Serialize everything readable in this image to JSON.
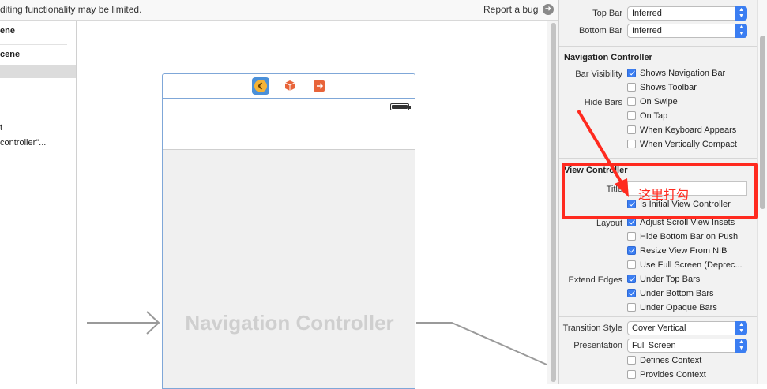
{
  "topbar": {
    "message": "diting functionality may be limited.",
    "report_label": "Report a bug",
    "report_icon": "arrow-right-circle-icon"
  },
  "outline": {
    "items": [
      "ene",
      "cene",
      "",
      "t",
      "controller\"..."
    ]
  },
  "scene": {
    "title": "Navigation Controller",
    "dock_icons": [
      "back-chevron-icon",
      "cube-icon",
      "exit-icon"
    ]
  },
  "inspector": {
    "top_bar_label": "Top Bar",
    "top_bar_value": "Inferred",
    "bottom_bar_label": "Bottom Bar",
    "bottom_bar_value": "Inferred",
    "nav_section": "Navigation Controller",
    "bar_visibility_label": "Bar Visibility",
    "shows_nav_bar": "Shows Navigation Bar",
    "shows_toolbar": "Shows Toolbar",
    "hide_bars_label": "Hide Bars",
    "on_swipe": "On Swipe",
    "on_tap": "On Tap",
    "when_keyboard": "When Keyboard Appears",
    "when_compact": "When Vertically Compact",
    "vc_section": "View Controller",
    "title_label": "Title",
    "title_value": "",
    "is_initial": "Is Initial View Controller",
    "layout_label": "Layout",
    "adjust_scroll": "Adjust Scroll View Insets",
    "hide_bottom_bar": "Hide Bottom Bar on Push",
    "resize_view": "Resize View From NIB",
    "use_full_screen": "Use Full Screen (Deprec...",
    "extend_edges_label": "Extend Edges",
    "under_top": "Under Top Bars",
    "under_bottom": "Under Bottom Bars",
    "under_opaque": "Under Opaque Bars",
    "transition_label": "Transition Style",
    "transition_value": "Cover Vertical",
    "presentation_label": "Presentation",
    "presentation_value": "Full Screen",
    "defines_context": "Defines Context",
    "provides_context": "Provides Context"
  },
  "annotation": {
    "text": "这里打勾"
  },
  "colors": {
    "accent": "#3b7ef2",
    "annotation_red": "#ff2a1f"
  }
}
